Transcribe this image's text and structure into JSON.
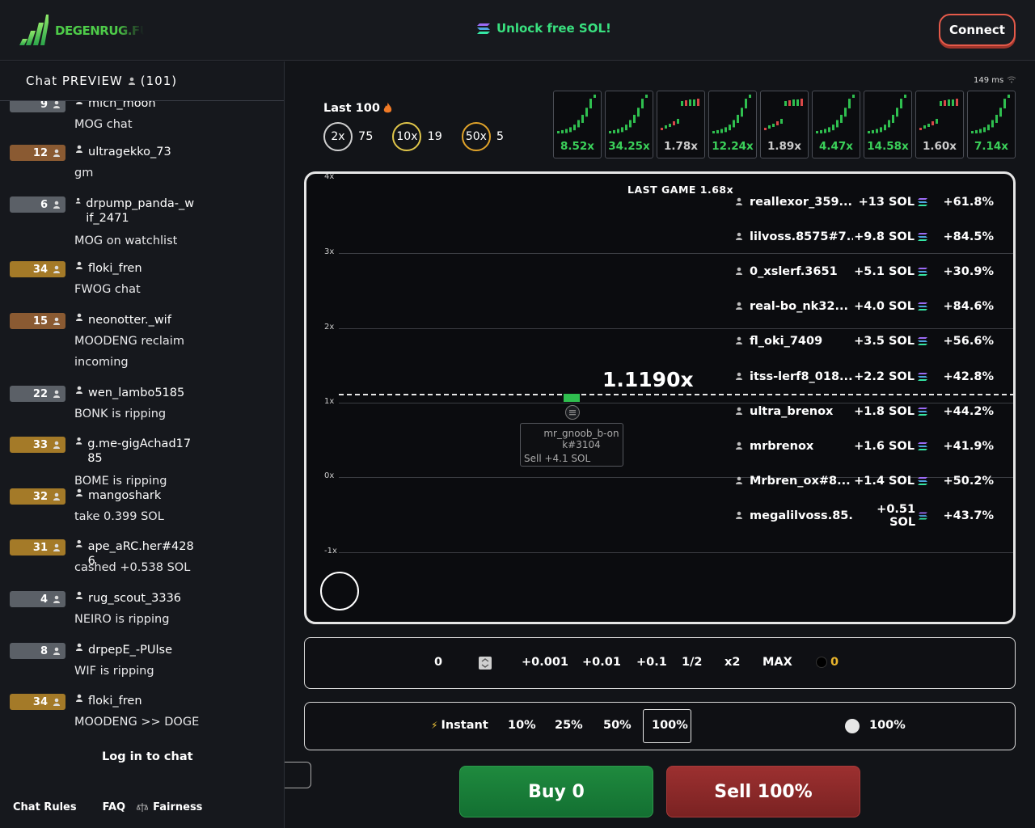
{
  "header": {
    "logo_text": "DEGENRUG.FUN",
    "promo": "Unlock free SOL!",
    "connect_label": "Connect"
  },
  "chat": {
    "title": "Chat PREVIEW",
    "count": "(101)",
    "messages": [
      {
        "level": "9",
        "user": "mich_moon",
        "text": "MOG chat",
        "lvl_color": "#5b6067"
      },
      {
        "level": "12",
        "user": "ultragekko_73",
        "text": "gm",
        "lvl_color": "#8a5a32"
      },
      {
        "level": "6",
        "user": "drpump_panda-_wif_2471",
        "text": "MOG on watchlist",
        "lvl_color": "#5b6067"
      },
      {
        "level": "34",
        "user": "floki_fren",
        "text": "FWOG chat",
        "lvl_color": "#a47a28"
      },
      {
        "level": "15",
        "user": "neonotter._wif",
        "text": "MOODENG reclaim incoming",
        "lvl_color": "#8a5a32"
      },
      {
        "level": "22",
        "user": "wen_lambo5185",
        "text": "BONK is ripping",
        "lvl_color": "#5b6067"
      },
      {
        "level": "33",
        "user": "g.me-gigAchad1785",
        "text": "BOME is ripping",
        "lvl_color": "#a47a28"
      },
      {
        "level": "32",
        "user": "mangoshark",
        "text": "take 0.399 SOL",
        "lvl_color": "#a47a28"
      },
      {
        "level": "31",
        "user": "ape_aRC.her#4286",
        "text": "cashed +0.538 SOL",
        "lvl_color": "#a47a28"
      },
      {
        "level": "4",
        "user": "rug_scout_3336",
        "text": "NEIRO is ripping",
        "lvl_color": "#5b6067"
      },
      {
        "level": "8",
        "user": "drpepE_-PUlse",
        "text": "WIF is ripping",
        "lvl_color": "#5b6067"
      },
      {
        "level": "34",
        "user": "floki_fren",
        "text": "MOODENG >> DOGE",
        "lvl_color": "#a47a28"
      }
    ],
    "login_label": "Log in to chat",
    "footer": {
      "rules": "Chat Rules",
      "faq": "FAQ",
      "fairness": "Fairness"
    }
  },
  "stats": {
    "ping": "149 ms",
    "last100_label": "Last 100",
    "badges": [
      {
        "label": "2x",
        "count": "75",
        "color": "#d0d0d0"
      },
      {
        "label": "10x",
        "count": "19",
        "color": "#e0c64a"
      },
      {
        "label": "50x",
        "count": "5",
        "color": "#e0a32a"
      }
    ],
    "history": [
      {
        "value": "8.52x",
        "green": true
      },
      {
        "value": "34.25x",
        "green": true
      },
      {
        "value": "1.78x",
        "green": false
      },
      {
        "value": "12.24x",
        "green": true
      },
      {
        "value": "1.89x",
        "green": false
      },
      {
        "value": "4.47x",
        "green": true
      },
      {
        "value": "14.58x",
        "green": true
      },
      {
        "value": "1.60x",
        "green": false
      },
      {
        "value": "7.14x",
        "green": true
      }
    ]
  },
  "game": {
    "last_game_label": "LAST GAME 1.68x",
    "current_multiplier": "1.1190x",
    "y_ticks": [
      "4x",
      "3x",
      "2x",
      "1x",
      "0x",
      "-1x"
    ],
    "tooltip": {
      "name": "mr_gnoob_b-onk#3104",
      "sell": "Sell +4.1 SOL"
    },
    "leaderboard": [
      {
        "name": "reallexor_359...",
        "sol": "+13 SOL",
        "pct": "+61.8%"
      },
      {
        "name": "lilvoss.8575#7...",
        "sol": "+9.8 SOL",
        "pct": "+84.5%"
      },
      {
        "name": "0_xslerf.3651",
        "sol": "+5.1 SOL",
        "pct": "+30.9%"
      },
      {
        "name": "real-bo_nk32...",
        "sol": "+4.0 SOL",
        "pct": "+84.6%"
      },
      {
        "name": "fl_oki_7409",
        "sol": "+3.5 SOL",
        "pct": "+56.6%"
      },
      {
        "name": "itss-lerf8_018...",
        "sol": "+2.2 SOL",
        "pct": "+42.8%"
      },
      {
        "name": "ultra_brenox",
        "sol": "+1.8 SOL",
        "pct": "+44.2%"
      },
      {
        "name": "mrbrenox",
        "sol": "+1.6 SOL",
        "pct": "+41.9%"
      },
      {
        "name": "Mrbren_ox#8...",
        "sol": "+1.4 SOL",
        "pct": "+50.2%"
      },
      {
        "name": "megalilvoss.85...",
        "sol": "+0.51 SOL",
        "pct": "+43.7%"
      }
    ]
  },
  "amount": {
    "value": "0",
    "buttons": [
      "+0.001",
      "+0.01",
      "+0.1",
      "1/2",
      "x2",
      "MAX"
    ],
    "balance": "0"
  },
  "sell_pct": {
    "instant_label": "Instant",
    "options": [
      "10%",
      "25%",
      "50%",
      "100%"
    ],
    "custom": "100%"
  },
  "actions": {
    "buy": "Buy 0",
    "sell": "Sell 100%"
  }
}
